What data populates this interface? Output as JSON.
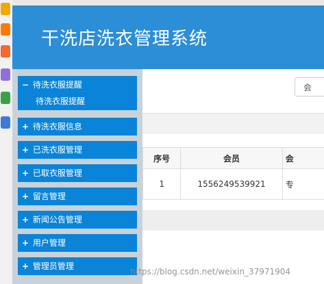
{
  "app": {
    "title": "干洗店洗衣管理系统"
  },
  "left_strip_icons": [
    {
      "name": "app-icon-1",
      "color": "#f0a900"
    },
    {
      "name": "app-icon-2",
      "color": "#ff7a00"
    },
    {
      "name": "app-icon-3",
      "color": "#f26a2f"
    },
    {
      "name": "app-icon-4",
      "color": "#8f70d6"
    },
    {
      "name": "app-icon-5",
      "color": "#3aa04a"
    },
    {
      "name": "app-icon-6",
      "color": "#3d7bd8"
    }
  ],
  "sidebar": {
    "groups": [
      {
        "sign": "−",
        "label": "待洗衣服提醒",
        "expanded": true,
        "items": [
          "待洗衣服提醒"
        ]
      },
      {
        "sign": "+",
        "label": "待洗衣服信息"
      },
      {
        "sign": "+",
        "label": "已洗衣服管理"
      },
      {
        "sign": "+",
        "label": "已取衣服管理"
      },
      {
        "sign": "+",
        "label": "留言管理"
      },
      {
        "sign": "+",
        "label": "新闻公告管理"
      },
      {
        "sign": "+",
        "label": "用户管理"
      },
      {
        "sign": "+",
        "label": "管理员管理"
      }
    ]
  },
  "main": {
    "toolbar_button_label": "会",
    "table": {
      "headers": [
        "序号",
        "会员",
        "会"
      ],
      "rows": [
        [
          "1",
          "1556249539921",
          "专"
        ]
      ]
    }
  },
  "watermark": "https://blog.csdn.net/weixin_37971904",
  "colors": {
    "header_blue": "#2b8ed6",
    "menu_blue": "#0a84d8",
    "sidebar_bg": "#c9d2d8"
  }
}
